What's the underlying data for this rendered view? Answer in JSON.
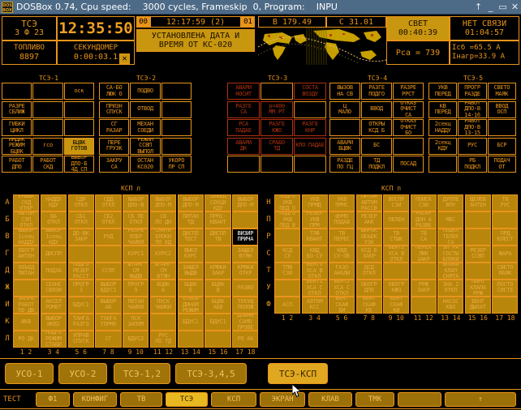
{
  "window": {
    "title": "DOSBox 0.74, Cpu speed:    3000 cycles, Frameskip  0, Program:    INPU",
    "logo_line1": "DOS",
    "logo_line2": "BOX",
    "buttons": {
      "up": "↑",
      "minimize": "_",
      "maximize": "▭",
      "close": "✕"
    }
  },
  "status": {
    "mode_label": "ТСЭ",
    "mode_sub": "З Ф 23",
    "clock": "12:35:50",
    "fuel_label": "ТОПЛИВО",
    "fuel_value": "8897",
    "stopwatch_label": "СЕКУНДОМЕР",
    "stopwatch_value": "0:00:03.1",
    "stopwatch_close": "✕",
    "msg_index_left": "00",
    "msg_time": "12:17:59 (2)",
    "msg_index_right": "01",
    "message_line1": "УСТАНОВЛЕНА ДАТА И",
    "message_line2": "ВРЕМЯ ОТ КС-020",
    "lon_label": "В 179.49",
    "lat_label": "С 31.01",
    "light_label": "СВЕТ",
    "light_value": "00:40:39",
    "nolink_label": "НЕТ СВЯЗИ",
    "nolink_value": "01:04:57",
    "psa_label": "Рса = 739",
    "isb_label": "Iсб  =65.5 А",
    "inagr_label": "Iнагр=33.9 А"
  },
  "tse": [
    {
      "title": "ТСЭ-1",
      "cells": [
        {
          "t": "",
          "s": "off"
        },
        {
          "t": "",
          "s": "off"
        },
        {
          "t": "оск",
          "s": "off"
        },
        {
          "t": "РАЗРЕ\nСБЛИЖ",
          "s": "off"
        },
        {
          "t": "",
          "s": "off"
        },
        {
          "t": "",
          "s": "off"
        },
        {
          "t": "ГИБКИ\nЦИКЛ",
          "s": "off"
        },
        {
          "t": "",
          "s": "off"
        },
        {
          "t": "",
          "s": "off"
        },
        {
          "t": "ИНДИК\nРЕЖИМ\nБЦВК",
          "s": "off"
        },
        {
          "t": "гсо",
          "s": "off"
        },
        {
          "t": "БЦВК\nГОТОВ",
          "s": "on"
        },
        {
          "t": "РАБОТ\nДПО",
          "s": "off"
        },
        {
          "t": "РАБОТ\nСКД",
          "s": "off"
        },
        {
          "t": "ВЫБОР\nДПО-Б\n4Д СП",
          "s": "off"
        }
      ]
    },
    {
      "title": "ТСЭ-2",
      "cells": [
        {
          "t": "СА-БО\nЛЮК О",
          "s": "off"
        },
        {
          "t": "ПОДВО",
          "s": "off"
        },
        {
          "t": "",
          "s": "off"
        },
        {
          "t": "ПРИЗН\nСПУСК",
          "s": "off"
        },
        {
          "t": "ОТВОД",
          "s": "off"
        },
        {
          "t": "",
          "s": "off"
        },
        {
          "t": "СГ\nРАЗАР",
          "s": "off"
        },
        {
          "t": "МЕХАН\nСОЕДИ",
          "s": "off"
        },
        {
          "t": "",
          "s": "off"
        },
        {
          "t": "ПЕРЕ\nГРУЗК",
          "s": "off"
        },
        {
          "t": "РЕЖИМ\nССВП\nВЫПОЛ",
          "s": "off"
        },
        {
          "t": "",
          "s": "off"
        },
        {
          "t": "ЗАКРУ\nСА",
          "s": "off"
        },
        {
          "t": "ОСТАН\nКС020",
          "s": "off"
        },
        {
          "t": "УКОРО\nПР СП",
          "s": "off"
        }
      ]
    },
    {
      "title": "ТСЭ-3",
      "cells": [
        {
          "t": "АВАРИ\nНОСИТ",
          "s": "red"
        },
        {
          "t": "",
          "s": "off"
        },
        {
          "t": "СОСТА\nВОЗДУ",
          "s": "red"
        },
        {
          "t": "РАЗГЕ\nСА",
          "s": "red"
        },
        {
          "t": "р=400\nММ РТ",
          "s": "red"
        },
        {
          "t": "",
          "s": "off"
        },
        {
          "t": "РСА\nПАДАЕ",
          "s": "red"
        },
        {
          "t": "РАЗГЕ\nКЖО",
          "s": "red"
        },
        {
          "t": "РАЗГЕ\nКНР",
          "s": "red"
        },
        {
          "t": "АВАРИ\nДК",
          "s": "red"
        },
        {
          "t": "СРАБО\nТД",
          "s": "red"
        },
        {
          "t": "КПО ПАДАЕ",
          "s": "red"
        },
        {
          "t": "",
          "s": "off"
        },
        {
          "t": "",
          "s": "off"
        },
        {
          "t": "",
          "s": "off"
        }
      ]
    },
    {
      "title": "ТСЭ-4",
      "cells": [
        {
          "t": "ВЫЗОВ\nНА СВ",
          "s": "off"
        },
        {
          "t": "РАЗГЕ\nПОДГО",
          "s": "off"
        },
        {
          "t": "РАЗРЕ\nРРСТ",
          "s": "off"
        },
        {
          "t": "Ц\nМАЛО",
          "s": "off"
        },
        {
          "t": "ВВОД",
          "s": "off"
        },
        {
          "t": "ОТКАЗ\nОЧИСТ\nСА",
          "s": "off"
        },
        {
          "t": "",
          "s": "off"
        },
        {
          "t": "ОТКРЫ\nКСД Б",
          "s": "off"
        },
        {
          "t": "ОТКАЗ\nОЧИСТ\nБО",
          "s": "off"
        },
        {
          "t": "АВАРИ\nБЦВК",
          "s": "off"
        },
        {
          "t": "БС",
          "s": "off"
        },
        {
          "t": "",
          "s": "off"
        },
        {
          "t": "РАЗДЕ\nПО ГЦ",
          "s": "off"
        },
        {
          "t": "ТД\nПОДКЛ",
          "s": "off"
        },
        {
          "t": "ПОСАД",
          "s": "off"
        }
      ]
    },
    {
      "title": "ТСЭ-5",
      "cells": [
        {
          "t": "УКВ\nПЕРЕД",
          "s": "off"
        },
        {
          "t": "ПРОГР\nРАЗДЕ",
          "s": "off"
        },
        {
          "t": "СВЕТО\nМАЯК",
          "s": "off"
        },
        {
          "t": "КВ\nПЕРЕД",
          "s": "off"
        },
        {
          "t": "РАБОТ\nДПО-В\n14-16",
          "s": "off"
        },
        {
          "t": "ВВОД\nОСП",
          "s": "off"
        },
        {
          "t": "2секц\nНАДДУ",
          "s": "off"
        },
        {
          "t": "РАБОТ\nДПО-В\n13-15",
          "s": "off"
        },
        {
          "t": "",
          "s": "off"
        },
        {
          "t": "2секц\nКДУ",
          "s": "off"
        },
        {
          "t": "РУС",
          "s": "off"
        },
        {
          "t": "БСР",
          "s": "off"
        },
        {
          "t": "",
          "s": "off"
        },
        {
          "t": "РБ\nПОДКЛ",
          "s": "off"
        },
        {
          "t": "ПОДАЧ\nОТ",
          "s": "off"
        }
      ]
    }
  ],
  "ksp_left": {
    "title": "КСП л",
    "row_labels": [
      "А",
      "Б",
      "В",
      "Г",
      "Д",
      "Ж",
      "И",
      "К",
      "Л"
    ],
    "col_labels": [
      "1  2",
      "3  4",
      "5  6",
      "7  8",
      "9  10",
      "11  12",
      "13  14",
      "15  16",
      "17  18"
    ],
    "rows": [
      [
        {
          "t": "КРЫШК\nСКД\nОТКР",
          "s": "f"
        },
        {
          "t": "НАДДУ\nКДУ",
          "s": "f"
        },
        {
          "t": "СДР\nОТКЛ",
          "s": "f"
        },
        {
          "t": "СДД\nОТКЛ",
          "s": "f"
        },
        {
          "t": "ВЫБОР\nДПО-В",
          "s": "f"
        },
        {
          "t": "ВЫБОР\nДПО-М",
          "s": "f"
        },
        {
          "t": "ВЫБОР\nДПО-М",
          "s": "f"
        },
        {
          "t": "ОБЪЕД\nСЕКЦИ\nКДУ",
          "s": "f"
        },
        {
          "t": "ВЫБОР\nДПО-М",
          "s": "f"
        }
      ],
      [
        {
          "t": "АВТОМ\nСЭП\nОТКЛ",
          "s": "f"
        },
        {
          "t": "ББ\nОТКЛ",
          "s": "f"
        },
        {
          "t": "СБ1\nОТКЛ",
          "s": "f"
        },
        {
          "t": "СБ2\nОТКЛ",
          "s": "f"
        },
        {
          "t": "СБ ЛЕ\nОТКЛ",
          "s": "f"
        },
        {
          "t": "СБ\nПО ДН",
          "s": "f"
        },
        {
          "t": "ПИТАН\nТД",
          "s": "f"
        },
        {
          "t": "ПРМ1-\nКВАНТ",
          "s": "f"
        },
        {
          "t": "",
          "s": "f"
        }
      ],
      [
        {
          "t": "ВЫБОР\n1секц\nНАДДУ",
          "s": "f"
        },
        {
          "t": "ВЫБОР\n1секц\nКДУ",
          "s": "f"
        },
        {
          "t": "ДО-ВК\nЗАКР",
          "s": "f"
        },
        {
          "t": "РУД",
          "s": "f"
        },
        {
          "t": "РАЗРЕ\nОПЕР\nЧАЙКИ",
          "s": "f"
        },
        {
          "t": "СНЯТИ\nБЛОКИ\nПО КД",
          "s": "f"
        },
        {
          "t": "ДИСПЛ\nТЕСТ",
          "s": "f"
        },
        {
          "t": "ДИСПЛ\nТВ",
          "s": "f"
        },
        {
          "t": "ВИЗИР\nПРИЧА",
          "s": "hi"
        }
      ],
      [
        {
          "t": "ОБОГР\nАНТЕН",
          "s": "f"
        },
        {
          "t": "ДИСПЛ",
          "s": "f"
        },
        {
          "t": "",
          "s": "f"
        },
        {
          "t": "",
          "s": "f"
        },
        {
          "t": "КУРС1",
          "s": "f"
        },
        {
          "t": "КУРС2",
          "s": "f"
        },
        {
          "t": "ВЫКЛ\nКУРС",
          "s": "f"
        },
        {
          "t": "",
          "s": "f"
        },
        {
          "t": "ЗАЩЕЛ\nВТЯН",
          "s": "f"
        }
      ],
      [
        {
          "t": "ОБЪЕД\nПИТАН",
          "s": "f"
        },
        {
          "t": "ПОДЗА",
          "s": "f"
        },
        {
          "t": "ПОДГО\nРЕЗЕР\nРАССТ",
          "s": "f"
        },
        {
          "t": "ССПП",
          "s": "f"
        },
        {
          "t": "ШТАНГ\nСМ\nВЫДВ",
          "s": "f"
        },
        {
          "t": "ШТАНГ\nСМ\nВТЯН",
          "s": "f"
        },
        {
          "t": "ЗАЩЕЛ\nВЫДВ",
          "s": "f"
        },
        {
          "t": "КРЮКИ\nЗАКР",
          "s": "f"
        },
        {
          "t": "КРЮКИ\nОТКР",
          "s": "f"
        }
      ],
      [
        {
          "t": "",
          "s": "f"
        },
        {
          "t": "СЕАНС\nСВЯЗИ",
          "s": "f"
        },
        {
          "t": "ПРОГР\n3",
          "s": "f"
        },
        {
          "t": "ВЫБОР\nБДУС1",
          "s": "f"
        },
        {
          "t": "ПРОГР\n9",
          "s": "f"
        },
        {
          "t": "БЦВК\nА",
          "s": "f"
        },
        {
          "t": "БЦВК\nБ",
          "s": "f"
        },
        {
          "t": "БЦВК\nВ",
          "s": "f"
        },
        {
          "t": "РАЗВО",
          "s": "f"
        }
      ],
      [
        {
          "t": "ЗАПРЕ\nРАБОТ\nПО ДВ",
          "s": "f"
        },
        {
          "t": "АКСЕЛ\nРОМЕТ",
          "s": "f"
        },
        {
          "t": "БДУС1",
          "s": "f"
        },
        {
          "t": "ВЫБОР\nАК",
          "s": "f"
        },
        {
          "t": "ПИТАН\nЧАЙКИ",
          "s": "f"
        },
        {
          "t": "ПУСК\nЧАЙКИ",
          "s": "f"
        },
        {
          "t": "ОТБОЙ\nДИНАМ\nРЕЖИМ",
          "s": "f"
        },
        {
          "t": "БЦВК\nАБВ",
          "s": "f"
        },
        {
          "t": "ТЕКУЩ\nПОЛОЖ",
          "s": "f"
        }
      ],
      [
        {
          "t": "ИКВ",
          "s": "f"
        },
        {
          "t": "ВЫБОР\nИКВ2",
          "s": "f"
        },
        {
          "t": "ТАНГА\nРАЗГО",
          "s": "f"
        },
        {
          "t": "ТАНГА\nТОРМО",
          "s": "f"
        },
        {
          "t": "ПСК\nЗАПОМ",
          "s": "f"
        },
        {
          "t": "",
          "s": "f"
        },
        {
          "t": "БДУС1",
          "s": "f"
        },
        {
          "t": "БДУС1",
          "s": "f"
        },
        {
          "t": "ДЛИНН\nСАМО\nПРОВЕ",
          "s": "f"
        }
      ],
      [
        {
          "t": "РО  ДК",
          "s": "f"
        },
        {
          "t": "ПОДГО\nРЕЖИМ\nСТАБИ",
          "s": "f"
        },
        {
          "t": "УПРАВ\nСПУСК",
          "s": "f"
        },
        {
          "t": "СГ",
          "s": "f"
        },
        {
          "t": "БДУС2",
          "s": "f"
        },
        {
          "t": "РУС\nПО ТД",
          "s": "f"
        },
        {
          "t": "",
          "s": "f"
        },
        {
          "t": "",
          "s": "f"
        },
        {
          "t": "РО  АК",
          "s": "f"
        }
      ]
    ]
  },
  "ksp_right": {
    "title": "КСП п",
    "row_labels": [
      "Н",
      "П",
      "Р",
      "С",
      "Т",
      "У",
      "Ф"
    ],
    "col_labels": [
      "1  2",
      "3  4",
      "5  6",
      "7  8",
      "9  10",
      "11  12",
      "13  14",
      "15  16",
      "17  18"
    ],
    "rows": [
      [
        {
          "t": "ПОДГО\nУКВ\nПЕД О",
          "s": "f"
        },
        {
          "t": "УКВ\nПРМД",
          "s": "f"
        },
        {
          "t": "УКВ\nПРМС",
          "s": "f"
        },
        {
          "t": "ПИТАН\nАВТОМ\nРАССВ",
          "s": "f"
        },
        {
          "t": "ВОСПР\nСЗИ",
          "s": "f"
        },
        {
          "t": "ПОИСК\nСЗИ",
          "s": "f"
        },
        {
          "t": "ДУПЛЕ\nВПУ",
          "s": "f"
        },
        {
          "t": "ЩЕЛЕВ\nАНТЕН",
          "s": "f"
        },
        {
          "t": "ТВ\nРУС",
          "s": "f"
        }
      ],
      [
        {
          "t": "ПОДГО\nУКВ\nПЕД В",
          "s": "f"
        },
        {
          "t": "РЕЗЕР\nУКВ\nПРМ",
          "s": "f"
        },
        {
          "t": "ШУМО\nПОДАВ",
          "s": "f"
        },
        {
          "t": "РЕЗЕР\nАКК",
          "s": "f"
        },
        {
          "t": "ПЕЛЕН",
          "s": "f"
        },
        {
          "t": "РАСКР\nДОН А\nРАЗВЕ",
          "s": "f"
        },
        {
          "t": "МБС",
          "s": "f"
        },
        {
          "t": "",
          "s": "f"
        },
        {
          "t": "",
          "s": "f"
        }
      ],
      [
        {
          "t": "",
          "s": "f"
        },
        {
          "t": "ТЛФ\nКВАНТ",
          "s": "f"
        },
        {
          "t": "ТВ\nПЕРЕС",
          "s": "f"
        },
        {
          "t": "ШИРОК\nОБЪЕК\nУЗК",
          "s": "f"
        },
        {
          "t": "ТВ\nСТЫК",
          "s": "f"
        },
        {
          "t": "ТВ\nСА",
          "s": "f"
        },
        {
          "t": "ПОДКЛ\nТЕЛЕК\nСА",
          "s": "f"
        },
        {
          "t": "",
          "s": "f"
        },
        {
          "t": "ПРД\nКЛЕСТ",
          "s": "f"
        }
      ],
      [
        {
          "t": "КСД\nСУ",
          "s": "f"
        },
        {
          "t": "КВД\nБО-СУ",
          "s": "f"
        },
        {
          "t": "КВД\nСУ-ОБ",
          "s": "f"
        },
        {
          "t": "КСД Б\nЗАКР",
          "s": "f"
        },
        {
          "t": "ВЕНТ2\nХСА В\nОТКЛ",
          "s": "f"
        },
        {
          "t": "ПЕРЕХ\nЛЮК\nЗАКР",
          "s": "f"
        },
        {
          "t": "ЭЛ РА\nСОСТЫ\nБЛОКИ",
          "s": "f"
        },
        {
          "t": "РЕЗЕР\nССВП",
          "s": "f"
        },
        {
          "t": "ФАРА",
          "s": "f"
        }
      ],
      [
        {
          "t": "ТЛФ\nСЗИ",
          "s": "f"
        },
        {
          "t": "ВЕНТ1\nХСА В\nОТКЛ",
          "s": "f"
        },
        {
          "t": "ГАЗО\nАНАЛИ",
          "s": "f"
        },
        {
          "t": "ДСД\nОТКЛ",
          "s": "f"
        },
        {
          "t": "",
          "s": "f"
        },
        {
          "t": "",
          "s": "f"
        },
        {
          "t": "БЛОКИ\nКЛАП\nСНЯТА",
          "s": "f"
        },
        {
          "t": "",
          "s": "f"
        },
        {
          "t": "СВЕТО\nМАЯК",
          "s": "f"
        }
      ],
      [
        {
          "t": "",
          "s": "f"
        },
        {
          "t": "ВЕНТ1\nХСА С\nОТКЛ",
          "s": "f"
        },
        {
          "t": "ВЕНТ2\nХСА С\nОТКЛ",
          "s": "f"
        },
        {
          "t": "ОБОГР\nДПО",
          "s": "f"
        },
        {
          "t": "ОБОГР\nКЖО",
          "s": "f"
        },
        {
          "t": "РРЖ\nЗАКР",
          "s": "f"
        },
        {
          "t": "ЗНА 2\nОТКЛ",
          "s": "f"
        },
        {
          "t": "ПИРО\nКЛАПА\nРРЖ",
          "s": "f"
        },
        {
          "t": "ПОСТО\nСИСТЕ",
          "s": "f"
        }
      ],
      [
        {
          "t": "АСП",
          "s": "f"
        },
        {
          "t": "АВТОМ\nКСС",
          "s": "f"
        },
        {
          "t": "ВЕНТ\nСКАФ\nБИ",
          "s": "f"
        },
        {
          "t": "ВЕНТ\nСКАФ\nКК",
          "s": "f"
        },
        {
          "t": "ВЕНТ\nСКАФ\nКИ",
          "s": "f"
        },
        {
          "t": "",
          "s": "f"
        },
        {
          "t": "НАСОС\nКВО",
          "s": "f"
        },
        {
          "t": "ВЕНТ\nДЫХАТ",
          "s": "f"
        },
        {
          "t": "",
          "s": "f"
        }
      ]
    ]
  },
  "page_buttons": [
    {
      "label": "УСО-1",
      "selected": false
    },
    {
      "label": "УСО-2",
      "selected": false
    },
    {
      "label": "ТСЭ-1,2",
      "selected": false
    },
    {
      "label": "ТСЭ-3,4,5",
      "selected": false
    },
    {
      "label": "ТСЭ-КСП",
      "selected": true
    }
  ],
  "test_bar": {
    "label": "ТЕСТ",
    "buttons": [
      {
        "label": "Ф1",
        "selected": false
      },
      {
        "label": "КОНФИГ",
        "selected": false
      },
      {
        "label": "ТВ",
        "selected": false
      },
      {
        "label": "ТСЭ",
        "selected": true
      },
      {
        "label": "КСП",
        "selected": false
      },
      {
        "label": "ЭКРАН",
        "selected": false
      },
      {
        "label": "КЛАВ",
        "selected": false
      },
      {
        "label": "ТМК",
        "selected": false
      },
      {
        "label": "",
        "selected": false
      },
      {
        "label": "↑",
        "selected": false
      }
    ]
  },
  "colors": {
    "amber": "#e8941a",
    "amber_fill": "#b8860b",
    "amber_bright": "#ffcc55",
    "red": "#b03010",
    "titlebar": "#4d6a86",
    "background": "#000000"
  }
}
